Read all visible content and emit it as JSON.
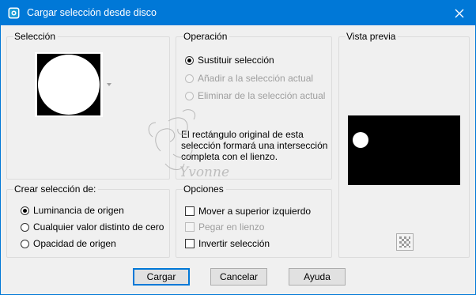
{
  "window": {
    "title": "Cargar selección desde disco"
  },
  "seleccion": {
    "legend": "Selección"
  },
  "operacion": {
    "legend": "Operación",
    "options": [
      {
        "label": "Sustituir selección",
        "checked": true,
        "enabled": true
      },
      {
        "label": "Añadir a la selección actual",
        "checked": false,
        "enabled": false
      },
      {
        "label": "Eliminar de la selección actual",
        "checked": false,
        "enabled": false
      }
    ],
    "description": [
      "El rectángulo original de esta",
      "selección formará una intersección",
      "completa con el lienzo."
    ]
  },
  "vista_previa": {
    "legend": "Vista previa"
  },
  "crear_seleccion": {
    "legend": "Crear selección de:",
    "options": [
      {
        "label": "Luminancia de origen",
        "checked": true
      },
      {
        "label": "Cualquier valor distinto de cero",
        "checked": false
      },
      {
        "label": "Opacidad de origen",
        "checked": false
      }
    ]
  },
  "opciones": {
    "legend": "Opciones",
    "items": [
      {
        "label": "Mover a superior izquierdo",
        "checked": false,
        "enabled": true
      },
      {
        "label": "Pegar en lienzo",
        "checked": false,
        "enabled": false
      },
      {
        "label": "Invertir selección",
        "checked": false,
        "enabled": true
      }
    ]
  },
  "buttons": {
    "load": "Cargar",
    "cancel": "Cancelar",
    "help": "Ayuda"
  },
  "watermark": {
    "text": "Yvonne"
  }
}
